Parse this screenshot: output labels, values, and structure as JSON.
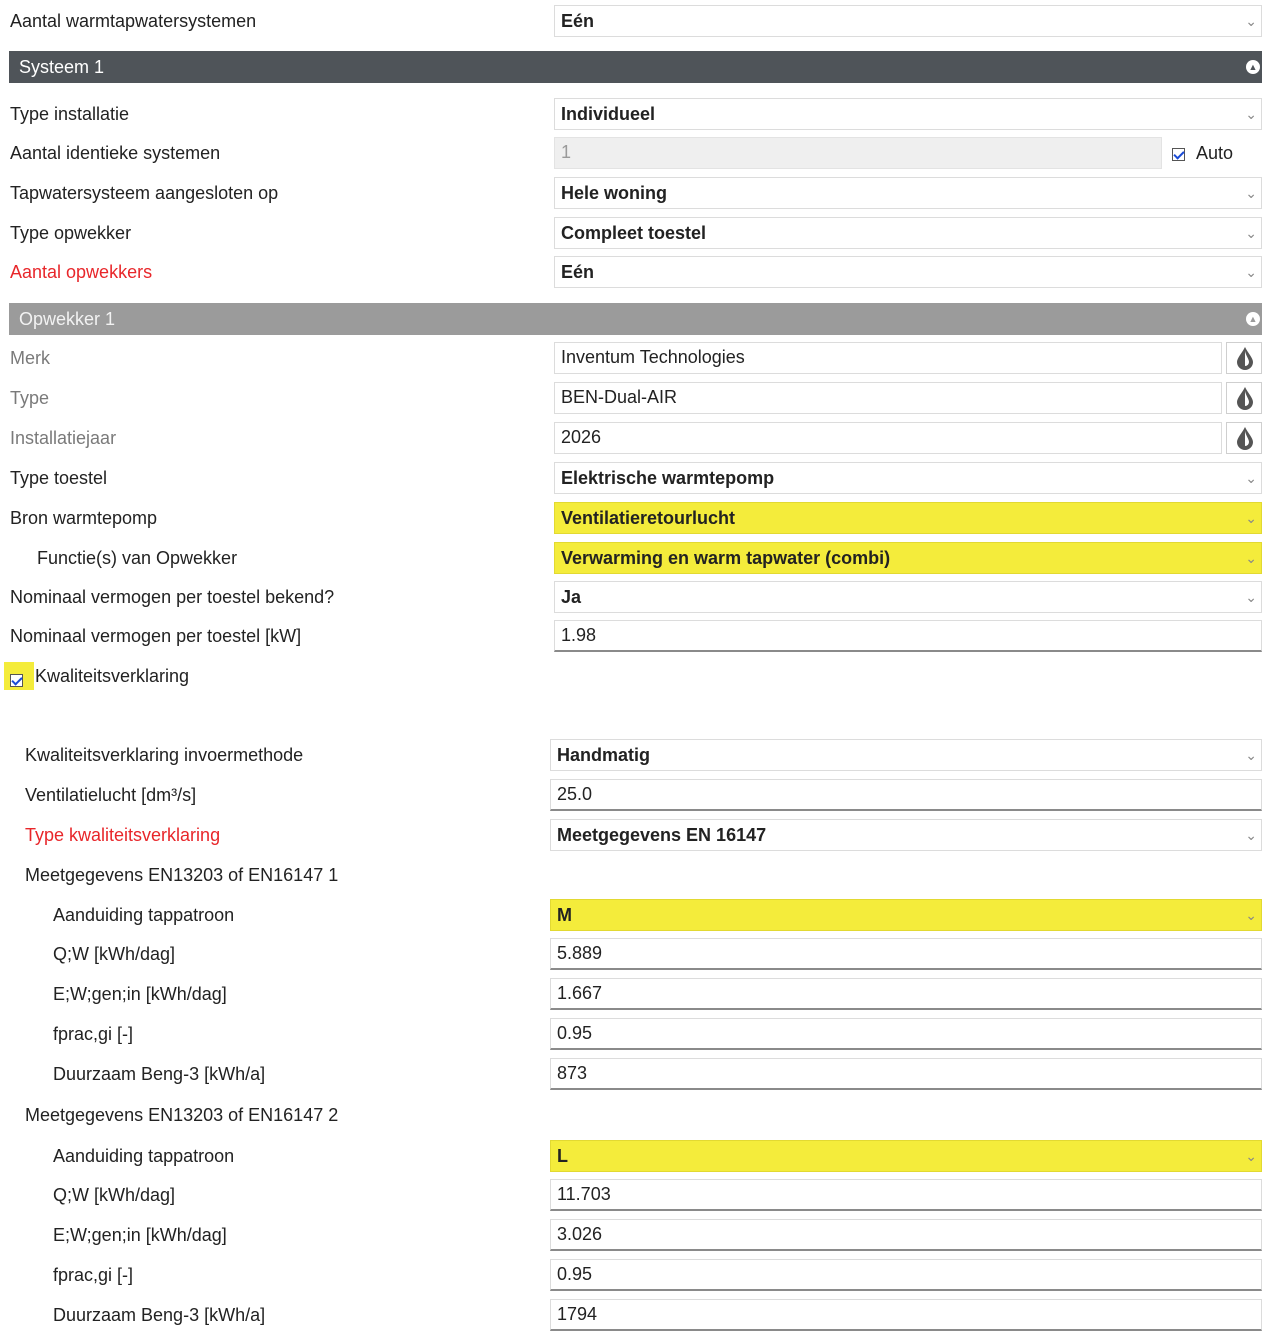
{
  "systems_count": {
    "label": "Aantal warmtapwatersystemen",
    "value": "Eén"
  },
  "system1": {
    "header": "Systeem 1",
    "type_installatie": {
      "label": "Type installatie",
      "value": "Individueel"
    },
    "aantal_identiek": {
      "label": "Aantal identieke systemen",
      "value": "1",
      "auto_label": "Auto"
    },
    "aangesloten_op": {
      "label": "Tapwatersysteem aangesloten op",
      "value": "Hele woning"
    },
    "type_opwekker": {
      "label": "Type opwekker",
      "value": "Compleet toestel"
    },
    "aantal_opwekkers": {
      "label": "Aantal opwekkers",
      "value": "Eén"
    }
  },
  "opwekker1": {
    "header": "Opwekker 1",
    "merk": {
      "label": "Merk",
      "value": "Inventum Technologies"
    },
    "type": {
      "label": "Type",
      "value": "BEN-Dual-AIR"
    },
    "installatiejaar": {
      "label": "Installatiejaar",
      "value": "2026"
    },
    "type_toestel": {
      "label": "Type toestel",
      "value": "Elektrische warmtepomp"
    },
    "bron": {
      "label": "Bron warmtepomp",
      "value": "Ventilatieretourlucht"
    },
    "functies": {
      "label": "Functie(s) van Opwekker",
      "value": "Verwarming en warm tapwater (combi)"
    },
    "nom_bekend": {
      "label": "Nominaal vermogen per toestel bekend?",
      "value": "Ja"
    },
    "nom_vermogen": {
      "label": "Nominaal vermogen per toestel [kW]",
      "value": "1.98"
    },
    "kwaliteitsverklaring": {
      "label": "Kwaliteitsverklaring"
    }
  },
  "kwaliteit": {
    "invoermethode": {
      "label": "Kwaliteitsverklaring invoermethode",
      "value": "Handmatig"
    },
    "ventilatielucht": {
      "label": "Ventilatielucht [dm³/s]",
      "value": "25.0"
    },
    "type_kv": {
      "label": "Type kwaliteitsverklaring",
      "value": "Meetgegevens EN 16147"
    },
    "meet1": {
      "title": "Meetgegevens EN13203 of EN16147 1",
      "tappatroon": {
        "label": "Aanduiding tappatroon",
        "value": "M"
      },
      "qw": {
        "label": "Q;W [kWh/dag]",
        "value": "5.889"
      },
      "ew": {
        "label": "E;W;gen;in [kWh/dag]",
        "value": "1.667"
      },
      "fprac": {
        "label": "fprac,gi [-]",
        "value": "0.95"
      },
      "duurzaam": {
        "label": "Duurzaam Beng-3 [kWh/a]",
        "value": "873"
      }
    },
    "meet2": {
      "title": "Meetgegevens EN13203 of EN16147 2",
      "tappatroon": {
        "label": "Aanduiding tappatroon",
        "value": "L"
      },
      "qw": {
        "label": "Q;W [kWh/dag]",
        "value": "11.703"
      },
      "ew": {
        "label": "E;W;gen;in [kWh/dag]",
        "value": "3.026"
      },
      "fprac": {
        "label": "fprac,gi [-]",
        "value": "0.95"
      },
      "duurzaam": {
        "label": "Duurzaam Beng-3 [kWh/a]",
        "value": "1794"
      }
    }
  },
  "colors": {
    "highlight": "#f4ec3b",
    "required_label": "#e8262a",
    "header_dark": "#4f5459",
    "header_mid": "#9b9b9b"
  },
  "icons": {
    "dropdown": "chevron-down-icon",
    "collapse": "collapse-icon",
    "database": "drop-icon",
    "checkbox": "checkbox-checked-icon"
  }
}
